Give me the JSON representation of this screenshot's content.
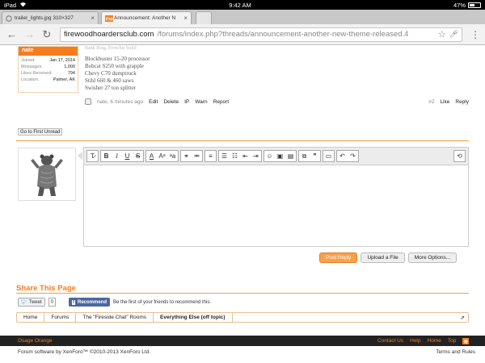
{
  "statusbar": {
    "device": "iPad",
    "time": "9:42 AM",
    "battery": "47%",
    "battery_level": 0.47
  },
  "tabs": [
    {
      "title": "trailer_lights.jpg 310×327",
      "active": false
    },
    {
      "title": "Announcement: Another N",
      "active": true
    }
  ],
  "address": {
    "host": "firewoodhoardersclub.com",
    "path": "/forums/index.php?threads/announcement-another-new-theme-released.4"
  },
  "post": {
    "top_line": "Bank Ring, Frenchie build",
    "user": {
      "name": "nate",
      "stats": [
        {
          "label": "Joined:",
          "value": "Jan 17, 2014"
        },
        {
          "label": "Messages:",
          "value": "1,000"
        },
        {
          "label": "Likes Received:",
          "value": "794"
        },
        {
          "label": "Location:",
          "value": "Palmer, AK"
        }
      ]
    },
    "signature": [
      "Blockbuster 15-20 processor",
      "Bobcat S250 with grapple",
      "Chevy C70 dumptruck",
      "Stihl 660 & 460 saws",
      "Swisher 27 ton splitter"
    ],
    "meta": "nate, 6 minutes ago",
    "actions": [
      "Edit",
      "Delete",
      "IP",
      "Warn",
      "Report"
    ],
    "number": "#2",
    "right_actions": [
      "Like",
      "Reply"
    ]
  },
  "go_to_first_unread": "Go to First Unread",
  "editor": {
    "buttons": [
      "Post Reply",
      "Upload a File",
      "More Options..."
    ]
  },
  "share": {
    "title": "Share This Page",
    "tweet_label": "Tweet",
    "tweet_count": "0",
    "fb_label": "Recommend",
    "fb_text": "Be the first of your friends to recommend this."
  },
  "breadcrumb": [
    "Home",
    "Forums",
    "The \"Fireside Chat\" Rooms",
    "Everything Else (off topic)"
  ],
  "footer": {
    "style": "Osage Orange",
    "links": [
      "Contact Us",
      "Help",
      "Home",
      "Top"
    ],
    "copyright": "Forum software by XenForo™ ©2010-2013 XenForo Ltd.",
    "terms": "Terms and Rules"
  },
  "colors": {
    "accent": "#f57d20",
    "footer_bg": "#222222",
    "facebook": "#4b67a1"
  }
}
